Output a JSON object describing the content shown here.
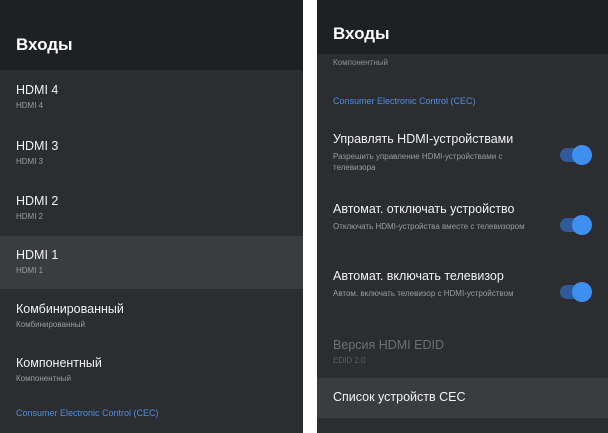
{
  "left": {
    "title": "Входы",
    "items": [
      {
        "label": "HDMI 4",
        "sub": "HDMI 4"
      },
      {
        "label": "HDMI 3",
        "sub": "HDMI 3"
      },
      {
        "label": "HDMI 2",
        "sub": "HDMI 2"
      },
      {
        "label": "HDMI 1",
        "sub": "HDMI 1"
      },
      {
        "label": "Комбинированный",
        "sub": "Комбинированный"
      },
      {
        "label": "Компонентный",
        "sub": "Компонентный"
      }
    ],
    "cec_section": "Consumer Electronic Control (CEC)"
  },
  "right": {
    "title": "Входы",
    "top_text": "Компонентный",
    "cec_section": "Consumer Electronic Control (CEC)",
    "settings": [
      {
        "label": "Управлять HDMI-устройствами",
        "desc": "Разрешить управление HDMI-устройствами с телевизора",
        "on": true
      },
      {
        "label": "Автомат. отключать устройство",
        "desc": "Отключать HDMI-устройства вместе с телевизором",
        "on": true
      },
      {
        "label": "Автомат. включать телевизор",
        "desc": "Автом. включать телевизор с HDMI-устройством",
        "on": true
      }
    ],
    "edid": {
      "label": "Версия HDMI EDID",
      "sub": "EDID 2.0"
    },
    "cec_list": "Список устройств CEC"
  },
  "colors": {
    "accent": "#3f8ff0",
    "panel": "#2b2d30",
    "header": "#1f2023",
    "selected": "#3a3c40"
  }
}
